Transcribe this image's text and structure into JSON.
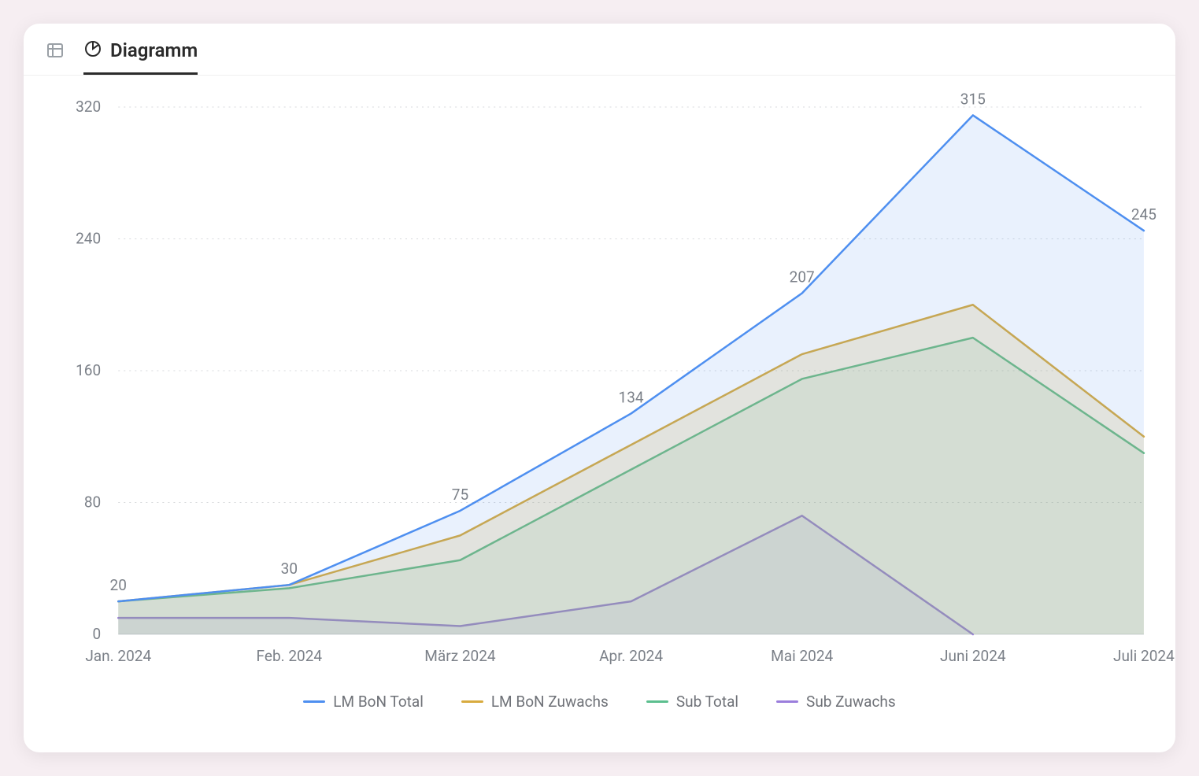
{
  "tabs": {
    "chart_label": "Diagramm"
  },
  "chart_data": {
    "type": "area",
    "categories": [
      "Jan. 2024",
      "Feb. 2024",
      "März 2024",
      "Apr. 2024",
      "Mai 2024",
      "Juni 2024",
      "Juli 2024"
    ],
    "series": [
      {
        "name": "LM BoN Total",
        "color": "#4e8ff0",
        "fill": "rgba(78,143,240,0.12)",
        "values": [
          20,
          30,
          75,
          134,
          207,
          315,
          245
        ]
      },
      {
        "name": "LM BoN Zuwachs",
        "color": "#d8ab3f",
        "fill": "rgba(216,171,63,0.18)",
        "values": [
          20,
          30,
          60,
          115,
          170,
          200,
          120
        ]
      },
      {
        "name": "Sub Total",
        "color": "#5cbf8f",
        "fill": "rgba(92,191,143,0.12)",
        "values": [
          20,
          28,
          45,
          100,
          155,
          180,
          110
        ]
      },
      {
        "name": "Sub Zuwachs",
        "color": "#9b7edc",
        "fill": "rgba(155,126,220,0.12)",
        "values": [
          10,
          10,
          5,
          20,
          72,
          0,
          null
        ]
      }
    ],
    "data_labels_series_index": 0,
    "yticks": [
      0,
      80,
      160,
      240,
      320
    ],
    "ylim": [
      0,
      320
    ],
    "xlabel": "",
    "ylabel": "",
    "title": ""
  }
}
